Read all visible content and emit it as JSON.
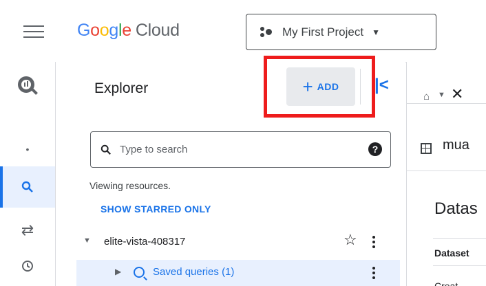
{
  "brand": {
    "logo_letters": [
      "G",
      "o",
      "o",
      "g",
      "l",
      "e"
    ],
    "logo_suffix": "Cloud"
  },
  "header": {
    "project_name": "My First Project"
  },
  "rail": {
    "items": [
      "overview-dot",
      "search-icon",
      "transfers-icon",
      "history-icon"
    ],
    "active": "search-icon"
  },
  "explorer": {
    "title": "Explorer",
    "add_label": "ADD",
    "search_placeholder": "Type to search",
    "help_label": "?",
    "viewing_text": "Viewing resources.",
    "show_starred_label": "SHOW STARRED ONLY",
    "project_id": "elite-vista-408317",
    "saved_queries_label": "Saved queries (1)"
  },
  "right_pane": {
    "table_name_partial": "mua",
    "heading_partial": "Datas",
    "column_partial": "Dataset",
    "cell_partial": "Creat"
  },
  "colors": {
    "accent": "#1a73e8",
    "highlight": "#ee1c1c",
    "selected_bg": "#e8f0fe"
  }
}
